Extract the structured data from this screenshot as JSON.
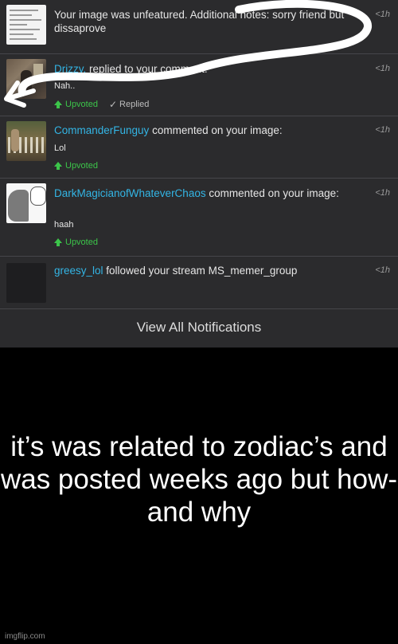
{
  "notifications": [
    {
      "thumb_icon": "document-thumbnail",
      "text": "Your image was unfeatured. Additional notes: sorry friend but dissaprove",
      "time": "<1h"
    },
    {
      "thumb_icon": "room-photo-thumbnail",
      "user": "Drizzy.",
      "action": " replied to your comment:",
      "comment": "Nah..",
      "time": "<1h",
      "upvoted": "Upvoted",
      "replied": "Replied"
    },
    {
      "thumb_icon": "garden-photo-thumbnail",
      "user": "CommanderFunguy",
      "action": " commented on your image:",
      "comment": "Lol",
      "time": "<1h",
      "upvoted": "Upvoted"
    },
    {
      "thumb_icon": "manga-thumbnail",
      "user": "DarkMagicianofWhateverChaos",
      "action": " commented on your image:",
      "comment": "haah",
      "time": "<1h",
      "upvoted": "Upvoted"
    },
    {
      "thumb_icon": "blank-avatar",
      "user": "greesy_lol",
      "action": " followed your stream MS_memer_group",
      "time": "<1h"
    }
  ],
  "view_all_label": "View All Notifications",
  "caption": "it’s was related to zodiac’s and was posted weeks ago but how- and why",
  "watermark": "imgflip.com",
  "colors": {
    "username": "#33b5e5",
    "upvote": "#3cc54a",
    "panel": "#2b2b2d"
  }
}
